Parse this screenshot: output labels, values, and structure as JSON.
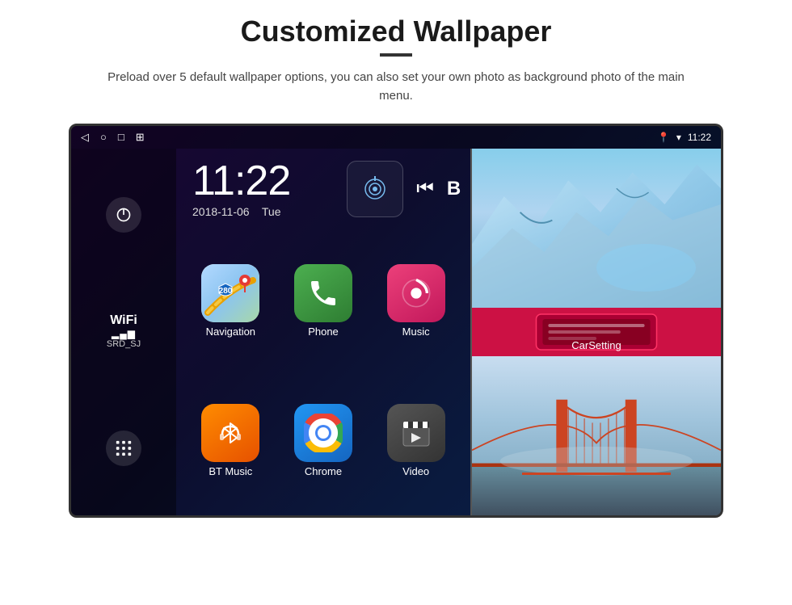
{
  "page": {
    "title": "Customized Wallpaper",
    "subtitle": "Preload over 5 default wallpaper options, you can also set your own photo as background photo of the main menu."
  },
  "device": {
    "status_bar": {
      "back_label": "◁",
      "home_label": "○",
      "recents_label": "□",
      "screenshot_label": "⊞",
      "location_icon": "📍",
      "wifi_icon": "▾",
      "time": "11:22"
    },
    "clock": {
      "time": "11:22",
      "date": "2018-11-06",
      "day": "Tue"
    },
    "wifi": {
      "label": "WiFi",
      "bars": "▂▄▆",
      "ssid": "SRD_SJ"
    },
    "apps": [
      {
        "name": "Navigation",
        "icon_type": "navigation"
      },
      {
        "name": "Phone",
        "icon_type": "phone"
      },
      {
        "name": "Music",
        "icon_type": "music"
      },
      {
        "name": "BT Music",
        "icon_type": "bt"
      },
      {
        "name": "Chrome",
        "icon_type": "chrome"
      },
      {
        "name": "Video",
        "icon_type": "video"
      }
    ],
    "right_panel": {
      "car_setting_label": "CarSetting"
    }
  }
}
